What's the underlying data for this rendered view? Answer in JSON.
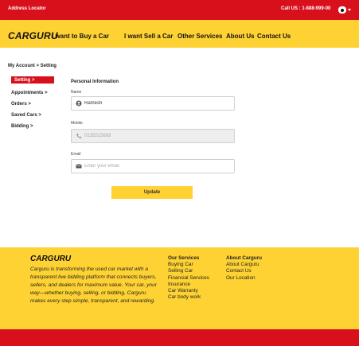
{
  "topbar": {
    "location_label": "Address Locator",
    "call_label": "Call US : 1-888-999-00"
  },
  "nav": {
    "brand": "CARGURU",
    "links": [
      "I want to Buy a Car",
      "I want Sell a Car",
      "Other Services",
      "About Us",
      "Contact Us"
    ]
  },
  "breadcrumb": "My Account > Setting",
  "sidebar": {
    "items": [
      "Setting >",
      "Appointments >",
      "Orders >",
      "Saved Cars >",
      "Bidding >"
    ]
  },
  "form": {
    "title": "Personal Information",
    "name_label": "Name",
    "name_value": "Ramesh",
    "mobile_label": "Mobile",
    "mobile_value": "0135515669",
    "email_label": "Email",
    "email_placeholder": "Enter your email",
    "update_label": "Update"
  },
  "footer": {
    "brand": "CARGURU",
    "description": "Carguru is transforming the used car market with a transparent live bidding platform that connects buyers, sellers, and dealers for maximum value. Your car, your way—whether buying, selling, or bidding, Carguru makes every step simple, transparent, and rewarding.",
    "services_title": "Our Services",
    "services": [
      "Buying Car",
      "Selling Car",
      "Financial Services",
      "Insurance",
      "Car Warranty",
      "Car body work"
    ],
    "about_title": "About Carguru",
    "about": [
      "About Carguru",
      "Contact Us",
      "Our Location"
    ]
  },
  "colors": {
    "red": "#d8101c",
    "yellow": "#ffd233"
  }
}
